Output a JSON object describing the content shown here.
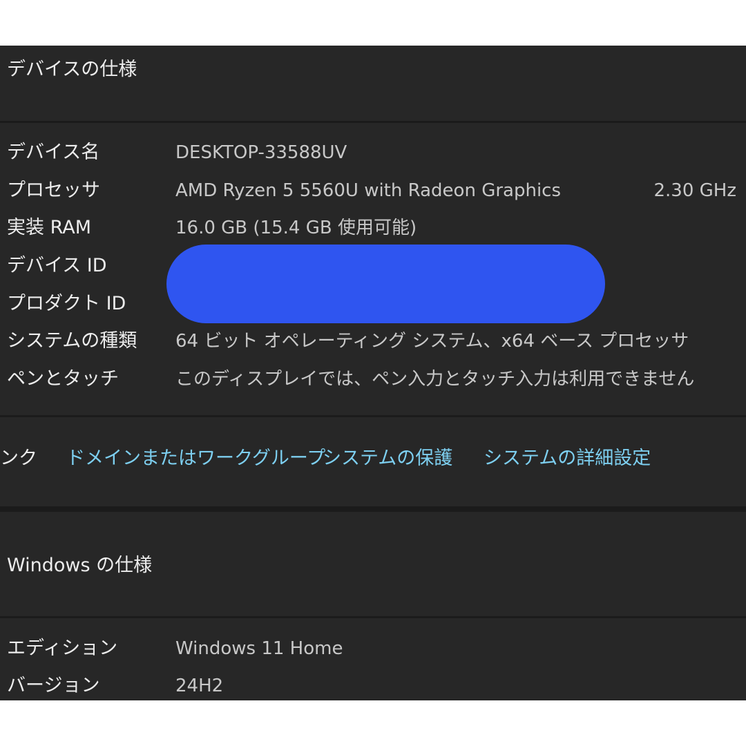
{
  "device_spec": {
    "title": "デバイスの仕様",
    "rows": [
      {
        "label": "デバイス名",
        "value": "DESKTOP-33588UV"
      },
      {
        "label": "プロセッサ",
        "value": "AMD Ryzen 5 5560U with Radeon Graphics",
        "extra": "2.30 GHz"
      },
      {
        "label": "実装 RAM",
        "value": "16.0 GB (15.4 GB 使用可能)"
      },
      {
        "label": "デバイス ID"
      },
      {
        "label": "プロダクト ID"
      },
      {
        "label": "システムの種類",
        "value": "64 ビット オペレーティング システム、x64 ベース プロセッサ"
      },
      {
        "label": "ペンとタッチ",
        "value": "このディスプレイでは、ペン入力とタッチ入力は利用できません"
      }
    ]
  },
  "related_links": {
    "lead_text": "ンク",
    "links": [
      "ドメインまたはワークグループ",
      "システムの保護",
      "システムの詳細設定"
    ]
  },
  "windows_spec": {
    "title": "Windows の仕様",
    "rows": [
      {
        "label": "エディション",
        "value": "Windows 11 Home"
      },
      {
        "label": "バージョン",
        "value": "24H2"
      }
    ]
  },
  "colors": {
    "panel_bg": "#272727",
    "link": "#7dcff0",
    "redaction": "#2f55f0"
  }
}
